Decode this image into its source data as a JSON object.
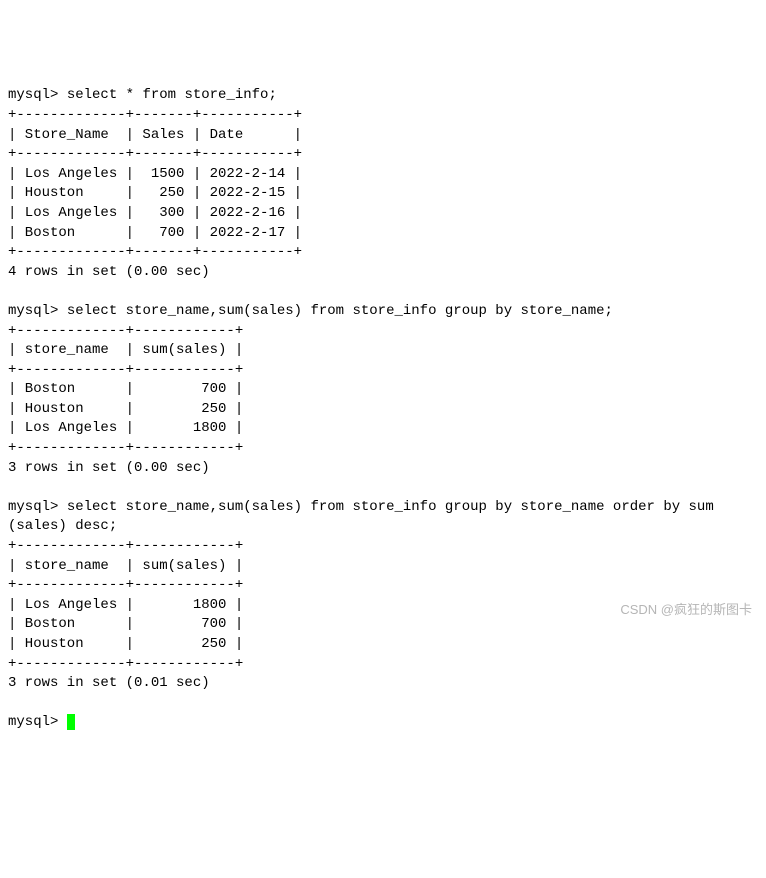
{
  "prompt": "mysql>",
  "queries": {
    "q1": {
      "sql": "select * from store_info;",
      "border_top": "+-------------+-------+-----------+",
      "header_row": "| Store_Name  | Sales | Date      |",
      "border_mid": "+-------------+-------+-----------+",
      "rows": [
        "| Los Angeles |  1500 | 2022-2-14 |",
        "| Houston     |   250 | 2022-2-15 |",
        "| Los Angeles |   300 | 2022-2-16 |",
        "| Boston      |   700 | 2022-2-17 |"
      ],
      "border_bot": "+-------------+-------+-----------+",
      "status": "4 rows in set (0.00 sec)"
    },
    "q2": {
      "sql": "select store_name,sum(sales) from store_info group by store_name;",
      "border_top": "+-------------+------------+",
      "header_row": "| store_name  | sum(sales) |",
      "border_mid": "+-------------+------------+",
      "rows": [
        "| Boston      |        700 |",
        "| Houston     |        250 |",
        "| Los Angeles |       1800 |"
      ],
      "border_bot": "+-------------+------------+",
      "status": "3 rows in set (0.00 sec)"
    },
    "q3": {
      "sql_line1": "select store_name,sum(sales) from store_info group by store_name order by sum",
      "sql_line2": "(sales) desc;",
      "border_top": "+-------------+------------+",
      "header_row": "| store_name  | sum(sales) |",
      "border_mid": "+-------------+------------+",
      "rows": [
        "| Los Angeles |       1800 |",
        "| Boston      |        700 |",
        "| Houston     |        250 |"
      ],
      "border_bot": "+-------------+------------+",
      "status": "3 rows in set (0.01 sec)"
    }
  },
  "watermark": "CSDN @疯狂的斯图卡",
  "chart_data": [
    {
      "type": "table",
      "title": "store_info",
      "columns": [
        "Store_Name",
        "Sales",
        "Date"
      ],
      "data": [
        {
          "Store_Name": "Los Angeles",
          "Sales": 1500,
          "Date": "2022-2-14"
        },
        {
          "Store_Name": "Houston",
          "Sales": 250,
          "Date": "2022-2-15"
        },
        {
          "Store_Name": "Los Angeles",
          "Sales": 300,
          "Date": "2022-2-16"
        },
        {
          "Store_Name": "Boston",
          "Sales": 700,
          "Date": "2022-2-17"
        }
      ]
    },
    {
      "type": "table",
      "title": "group by store_name",
      "columns": [
        "store_name",
        "sum(sales)"
      ],
      "data": [
        {
          "store_name": "Boston",
          "sum(sales)": 700
        },
        {
          "store_name": "Houston",
          "sum(sales)": 250
        },
        {
          "store_name": "Los Angeles",
          "sum(sales)": 1800
        }
      ]
    },
    {
      "type": "table",
      "title": "group by store_name order by sum(sales) desc",
      "columns": [
        "store_name",
        "sum(sales)"
      ],
      "data": [
        {
          "store_name": "Los Angeles",
          "sum(sales)": 1800
        },
        {
          "store_name": "Boston",
          "sum(sales)": 700
        },
        {
          "store_name": "Houston",
          "sum(sales)": 250
        }
      ]
    }
  ]
}
